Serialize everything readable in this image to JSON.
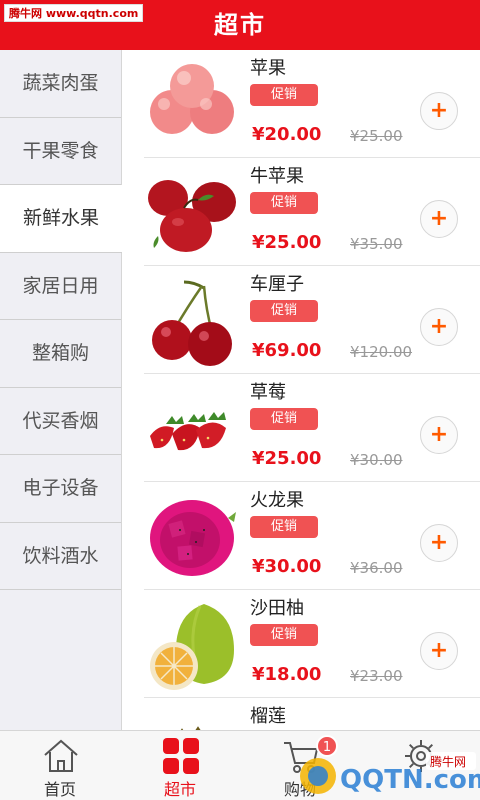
{
  "watermark_top": "腾牛网 www.qqtn.com",
  "header": {
    "title": "超市"
  },
  "sidebar": {
    "items": [
      {
        "label": "蔬菜肉蛋"
      },
      {
        "label": "干果零食"
      },
      {
        "label": "新鲜水果",
        "active": true
      },
      {
        "label": "家居日用"
      },
      {
        "label": "整箱购"
      },
      {
        "label": "代买香烟"
      },
      {
        "label": "电子设备"
      },
      {
        "label": "饮料酒水"
      }
    ]
  },
  "products": [
    {
      "name": "苹果",
      "tag": "促销",
      "price": "¥20.00",
      "original_price": "¥25.00"
    },
    {
      "name": "牛苹果",
      "tag": "促销",
      "price": "¥25.00",
      "original_price": "¥35.00"
    },
    {
      "name": "车厘子",
      "tag": "促销",
      "price": "¥69.00",
      "original_price": "¥120.00"
    },
    {
      "name": "草莓",
      "tag": "促销",
      "price": "¥25.00",
      "original_price": "¥30.00"
    },
    {
      "name": "火龙果",
      "tag": "促销",
      "price": "¥30.00",
      "original_price": "¥36.00"
    },
    {
      "name": "沙田柚",
      "tag": "促销",
      "price": "¥18.00",
      "original_price": "¥23.00"
    },
    {
      "name": "榴莲"
    }
  ],
  "add_icon": "plus-icon",
  "tabbar": {
    "tabs": [
      {
        "label": "首页",
        "icon": "home-icon"
      },
      {
        "label": "超市",
        "icon": "grid-icon",
        "active": true
      },
      {
        "label": "购物",
        "icon": "cart-icon",
        "badge": "1"
      },
      {
        "icon": "gear-icon"
      }
    ]
  },
  "watermark_bottom": {
    "brand": "QQTN.com",
    "sub": "腾牛网"
  },
  "colors": {
    "brand_red": "#e8111b",
    "promo_red": "#f05253",
    "add_orange": "#ff5a00"
  }
}
